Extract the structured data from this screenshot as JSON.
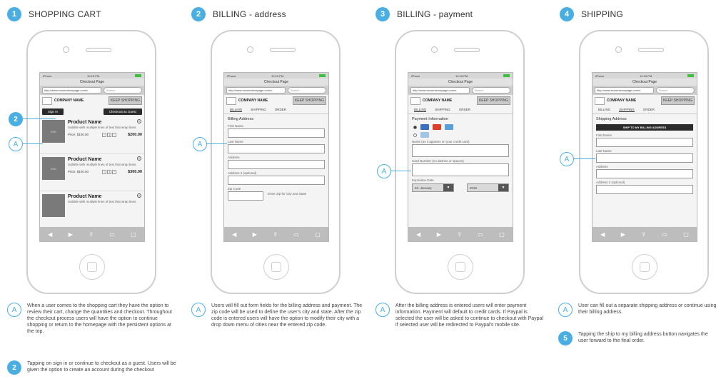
{
  "steps": [
    {
      "number": "1",
      "title": "SHOPPING CART"
    },
    {
      "number": "2",
      "title": "BILLING - address"
    },
    {
      "number": "3",
      "title": "BILLING - payment"
    },
    {
      "number": "4",
      "title": "SHIPPING"
    }
  ],
  "phone": {
    "carrier": "iPhone",
    "time": "10:15 PM",
    "page_title": "Checkout Page",
    "url": "http://www.ecommercepage.com/n",
    "search_placeholder": "Search",
    "company_name": "COMPANY NAME",
    "keep_shopping": "KEEP SHOPPING",
    "tabs": [
      "BILLING",
      "SHIPPING",
      "ORDER"
    ]
  },
  "cart": {
    "sign_in": "Sign In",
    "checkout_guest": "Checkout as Guest",
    "products": [
      {
        "image": "IMG",
        "name": "Product Name",
        "subtitle": "Subtitle with multiple lines of text that wrap lines.",
        "price": "Price: $100.00",
        "qty": "1",
        "total": "$200.00"
      },
      {
        "image": "IMG",
        "name": "Product Name",
        "subtitle": "Subtitle with multiple lines of text that wrap lines.",
        "price": "Price: $100.00",
        "qty": "1",
        "total": "$300.00"
      },
      {
        "image": "IMG",
        "name": "Product Name",
        "subtitle": "Subtitle with multiple lines of text that wrap lines.",
        "price": "",
        "qty": "",
        "total": ""
      }
    ]
  },
  "billing_address": {
    "heading": "Billing Address",
    "fields": [
      "First Name",
      "Last Name",
      "Address",
      "Address 2 (optional)"
    ],
    "zip_label": "Zip Code",
    "zip_hint": "Enter Zip for City and State"
  },
  "billing_payment": {
    "heading": "Payment Information",
    "name_label": "Name (as it appears on your credit card)",
    "card_label": "Card Number (no dashes or spaces)",
    "expiration_label": "Expiration Date",
    "month": "01- January",
    "year": "2015"
  },
  "shipping": {
    "heading": "Shipping Address",
    "ship_button": "SHIP TO MY BILLING ADDRESS",
    "fields": [
      "First Name",
      "Last Name",
      "Address",
      "Address 2 (optional)"
    ]
  },
  "callouts": {
    "a": "A",
    "two": "2",
    "five": "5"
  },
  "notes": {
    "cart_a": "When a user comes to the shopping cart they have the option to review their cart, change the quantities and checkout. Throughout the checkout process users will have the option to continue shopping or return to the homepage with the persistent options at the top.",
    "cart_2": "Tapping on sign in or continue to checkout as a guest. Users will be given the option to create an account during the checkout",
    "address_a": "Users will fill out form fields for the billing address and payment. The zip code will be used to define the user's city and state. After the zip code is entered users will have the option to modify their city with a drop down menu of cities near the entered zip code.",
    "payment_a": "After the billing address is entered users will enter payment information. Payment will default to credit cards. If Paypal is selected the user will be asked to continue to checkout with Paypal if selected user will be redirected to Paypal's mobile site.",
    "shipping_a": "User can fill out a separate shipping address or continue using their billing address.",
    "shipping_5": "Tapping the ship to my billing address button navigates the user forward to the final order."
  },
  "colors": {
    "accent": "#4aaee3",
    "dark_button": "#2b2b2b",
    "battery": "#3fbf3f"
  }
}
